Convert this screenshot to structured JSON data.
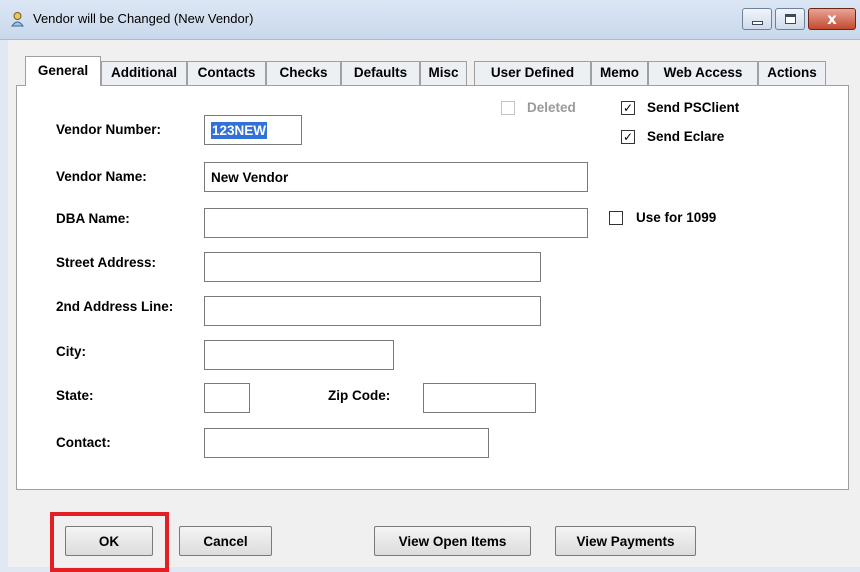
{
  "window": {
    "title": "Vendor will be Changed (New Vendor)",
    "close_glyph": "x"
  },
  "tabs": [
    {
      "label": "General",
      "active": true
    },
    {
      "label": "Additional"
    },
    {
      "label": "Contacts"
    },
    {
      "label": "Checks"
    },
    {
      "label": "Defaults"
    },
    {
      "label": "Misc"
    },
    {
      "label": "User Defined"
    },
    {
      "label": "Memo"
    },
    {
      "label": "Web Access"
    },
    {
      "label": "Actions"
    }
  ],
  "checkboxes": {
    "deleted": {
      "label": "Deleted",
      "checked": false,
      "enabled": false
    },
    "send_psclient": {
      "label": "Send PSClient",
      "checked": true
    },
    "send_eclare": {
      "label": "Send Eclare",
      "checked": true
    },
    "use_for_1099": {
      "label": "Use for 1099",
      "checked": false
    }
  },
  "check_glyph": "✓",
  "form": {
    "vendor_number": {
      "label": "Vendor Number:",
      "value": "123NEW"
    },
    "vendor_name": {
      "label": "Vendor Name:",
      "value": "New Vendor"
    },
    "dba_name": {
      "label": "DBA Name:",
      "value": ""
    },
    "street_address": {
      "label": "Street Address:",
      "value": ""
    },
    "address_line2": {
      "label": "2nd Address Line:",
      "value": ""
    },
    "city": {
      "label": "City:",
      "value": ""
    },
    "state": {
      "label": "State:",
      "value": ""
    },
    "zip_code": {
      "label": "Zip Code:",
      "value": ""
    },
    "contact": {
      "label": "Contact:",
      "value": ""
    }
  },
  "buttons": {
    "ok": "OK",
    "cancel": "Cancel",
    "view_open_items": "View Open Items",
    "view_payments": "View Payments"
  },
  "colors": {
    "highlight": "#e31e24",
    "selection": "#3271d7"
  }
}
